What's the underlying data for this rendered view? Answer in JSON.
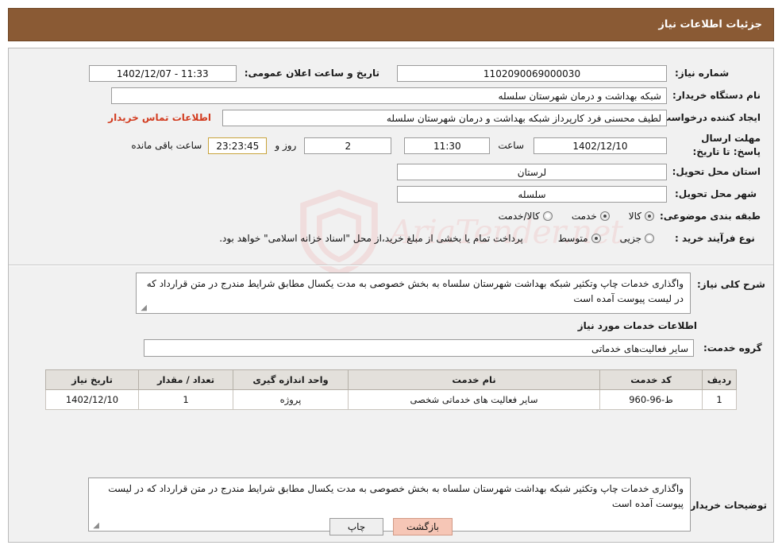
{
  "header": {
    "title": "جزئیات اطلاعات نیاز"
  },
  "form": {
    "need_number_label": "شماره نیاز:",
    "need_number_value": "1102090069000030",
    "public_announce_label": "تاریخ و ساعت اعلان عمومی:",
    "public_announce_value": "11:33 - 1402/12/07",
    "buyer_org_label": "نام دستگاه خریدار:",
    "buyer_org_value": "شبکه بهداشت و درمان شهرستان سلسله",
    "requester_label": "ایجاد کننده درخواست:",
    "requester_value": "لطیف  محسنی فرد کارپرداز شبکه بهداشت و درمان شهرستان سلسله",
    "contact_link": "اطلاعات تماس خریدار",
    "deadline_label": "مهلت ارسال پاسخ: تا تاریخ:",
    "deadline_date": "1402/12/10",
    "hour_label": "ساعت",
    "deadline_time": "11:30",
    "days_value": "2",
    "days_label": "روز و",
    "remaining_value": "23:23:45",
    "remaining_label": "ساعت باقی مانده",
    "province_label": "استان محل تحویل:",
    "province_value": "لرستان",
    "city_label": "شهر محل تحویل:",
    "city_value": "سلسله",
    "category_label": "طبقه بندی موضوعی:",
    "category_options": [
      {
        "label": "کالا",
        "selected": false
      },
      {
        "label": "خدمت",
        "selected": true
      },
      {
        "label": "کالا/خدمت",
        "selected": false
      }
    ],
    "process_label": "نوع فرآیند خرید :",
    "process_options": [
      {
        "label": "جزیی",
        "selected": false
      },
      {
        "label": "متوسط",
        "selected": true
      }
    ],
    "process_note": "پرداخت تمام یا بخشی از مبلغ خرید،از محل \"اسناد خزانه اسلامی\" خواهد بود."
  },
  "general": {
    "label": "شرح کلی نیاز:",
    "text": "واگذاری خدمات چاپ وتکثیر شبکه بهداشت شهرستان سلساه به بخش خصوصی به مدت یکسال مطابق شرایط مندرج در متن قرارداد که در لیست پیوست آمده است"
  },
  "services": {
    "section_title": "اطلاعات خدمات مورد نیاز",
    "group_label": "گروه خدمت:",
    "group_value": "سایر فعالیت‌های خدماتی",
    "columns": [
      "ردیف",
      "کد خدمت",
      "نام خدمت",
      "واحد اندازه گیری",
      "تعداد / مقدار",
      "تاریخ نیاز"
    ],
    "rows": [
      {
        "row": "1",
        "code": "ط-96-960",
        "name": "سایر فعالیت های خدماتی شخصی",
        "unit": "پروژه",
        "qty": "1",
        "date": "1402/12/10"
      }
    ]
  },
  "buyer_notes": {
    "label": "توضیحات خریدار:",
    "text": "واگذاری خدمات چاپ وتکثیر شبکه بهداشت شهرستان سلساه به بخش خصوصی به مدت یکسال مطابق شرایط مندرج در متن قرارداد که در لیست پیوست آمده است"
  },
  "footer": {
    "print_label": "چاپ",
    "back_label": "بازگشت"
  },
  "watermark": {
    "text": "AriaTender.net"
  },
  "colors": {
    "header_bg": "#8a5a34",
    "link": "#d23b1f",
    "back_button": "#f6c6b6"
  }
}
